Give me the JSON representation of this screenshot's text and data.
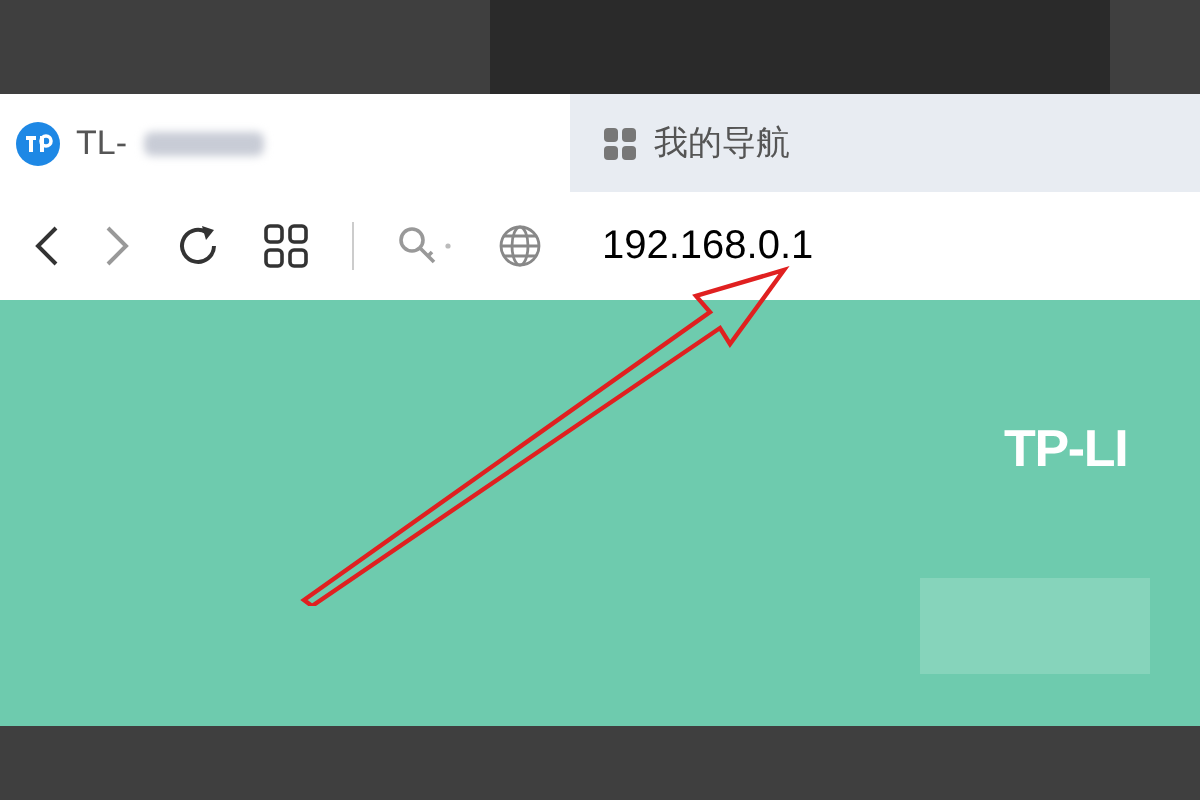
{
  "tabs": [
    {
      "kind": "site",
      "title": "TL-",
      "selected": true
    },
    {
      "kind": "grid",
      "title": "我的导航",
      "selected": false
    }
  ],
  "address": {
    "url": "192.168.0.1"
  },
  "page": {
    "logo": "TP-LI"
  }
}
